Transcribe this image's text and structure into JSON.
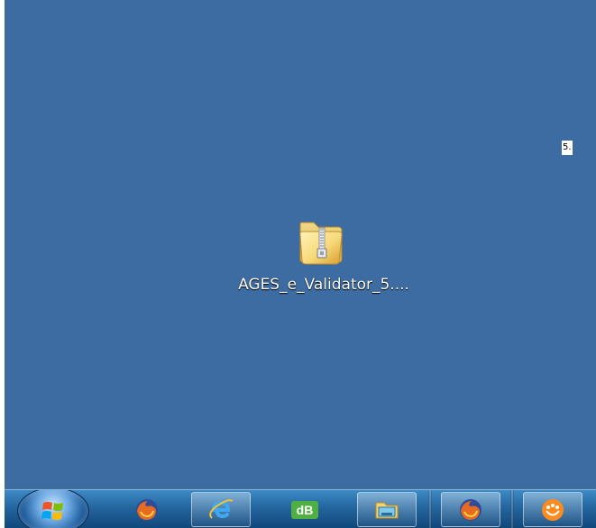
{
  "desktop": {
    "corner_label": "5.",
    "file": {
      "icon": "zip-folder-icon",
      "label": "AGES_e_Validator_5...."
    }
  },
  "taskbar": {
    "start_icon": "windows-logo-icon",
    "items": [
      {
        "icon": "firefox-icon"
      },
      {
        "icon": "internet-explorer-icon"
      },
      {
        "icon": "db-app-icon",
        "label": "dB"
      },
      {
        "icon": "folder-icon"
      },
      {
        "icon": "firefox-icon"
      },
      {
        "icon": "messenger-icon"
      }
    ]
  },
  "colors": {
    "desktop": "#3c6ca2",
    "taskbar": "#23649d",
    "accent": "#4fb041"
  }
}
